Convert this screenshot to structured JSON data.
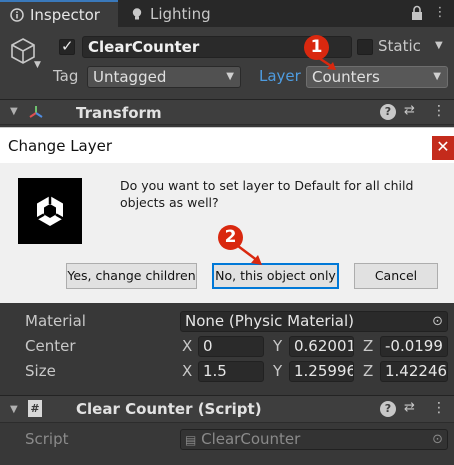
{
  "tabs": [
    {
      "label": "Inspector",
      "icon": "info-icon"
    },
    {
      "label": "Lighting",
      "icon": "lightbulb-icon"
    }
  ],
  "object": {
    "name": "ClearCounter",
    "static_label": "Static",
    "tag_label": "Tag",
    "tag_value": "Untagged",
    "layer_label": "Layer",
    "layer_value": "Counters"
  },
  "transform": {
    "title": "Transform"
  },
  "dialog": {
    "title": "Change Layer",
    "close": "✕",
    "message_line1": "Do you want to set layer to Default for all child",
    "message_line2": "objects as well?",
    "buttons": {
      "yes": "Yes, change children",
      "no": "No, this object only",
      "cancel": "Cancel"
    }
  },
  "annotations": {
    "one": "1",
    "two": "2"
  },
  "collider": {
    "material_label": "Material",
    "material_value": "None (Physic Material)",
    "center_label": "Center",
    "center": {
      "x": "0",
      "y": "0.62001",
      "z": "-0.0199"
    },
    "size_label": "Size",
    "size": {
      "x": "1.5",
      "y": "1.25996",
      "z": "1.42246"
    },
    "axis_x": "X",
    "axis_y": "Y",
    "axis_z": "Z"
  },
  "script_component": {
    "title": "Clear Counter (Script)",
    "script_label": "Script",
    "script_value": "ClearCounter"
  },
  "colors": {
    "accent": "#3a79bb",
    "badge": "#d9280f",
    "close": "#c42b1c"
  }
}
